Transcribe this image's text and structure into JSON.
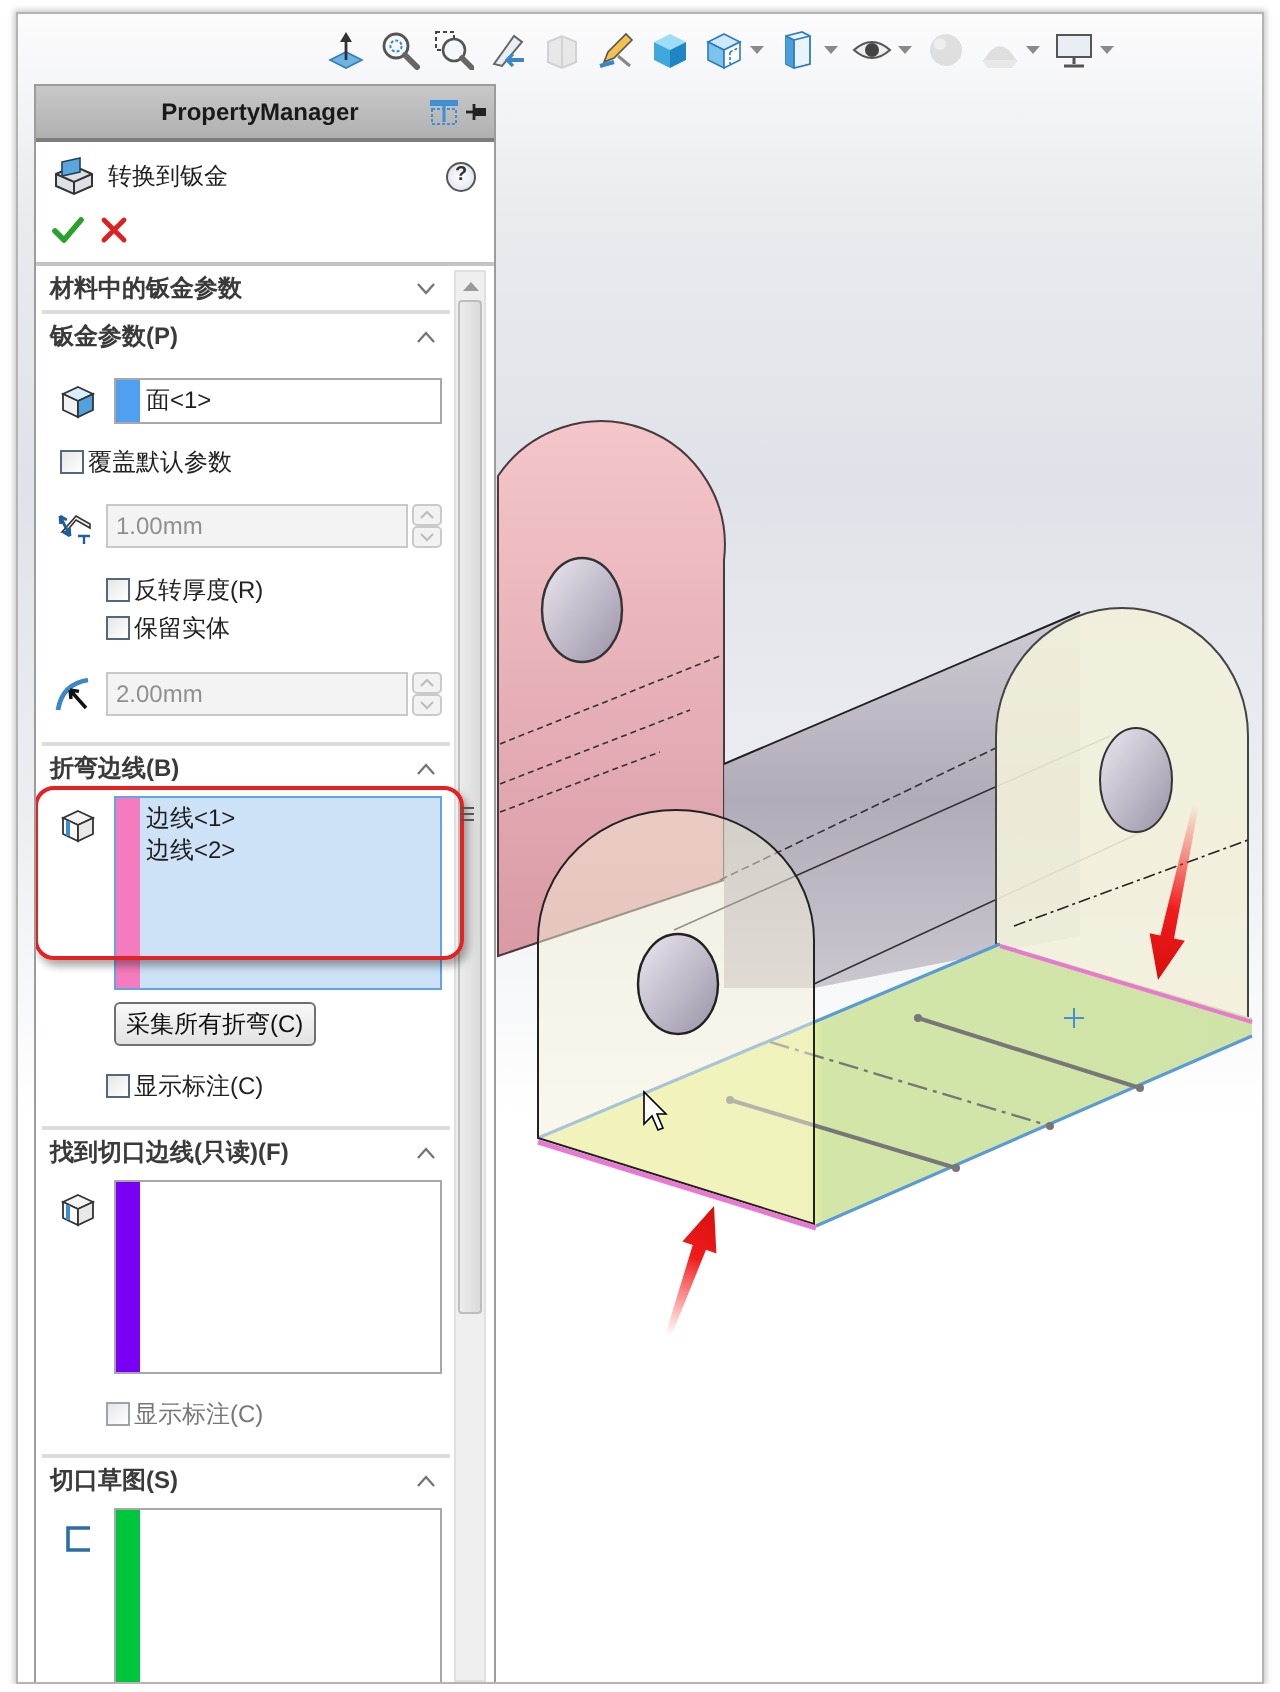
{
  "toolbar": [
    {
      "kind": "triad",
      "disabled": false,
      "menu": false
    },
    {
      "kind": "zoomfit",
      "disabled": false,
      "menu": false
    },
    {
      "kind": "zoomarea",
      "disabled": false,
      "menu": false
    },
    {
      "kind": "previous",
      "disabled": false,
      "menu": false
    },
    {
      "kind": "section",
      "disabled": true,
      "menu": false
    },
    {
      "kind": "annotation",
      "disabled": false,
      "menu": false
    },
    {
      "kind": "shaded",
      "disabled": false,
      "menu": false
    },
    {
      "kind": "hidden",
      "disabled": false,
      "menu": true
    },
    {
      "kind": "display",
      "disabled": false,
      "menu": true
    },
    {
      "kind": "eye",
      "disabled": false,
      "menu": true
    },
    {
      "kind": "appearance",
      "disabled": true,
      "menu": false
    },
    {
      "kind": "scene",
      "disabled": true,
      "menu": true
    },
    {
      "kind": "monitor",
      "disabled": false,
      "menu": true
    }
  ],
  "property_manager": {
    "header": "PropertyManager",
    "title": "转换到钣金",
    "help": "?",
    "sections": [
      {
        "title": "材料中的钣金参数",
        "expanded": false
      },
      {
        "title": "钣金参数(P)",
        "expanded": true,
        "rows": [
          {
            "kind": "face",
            "value": "面<1>",
            "color": "#4fa0f0"
          },
          {
            "kind": "checkbox",
            "label": "覆盖默认参数",
            "checked": false,
            "disabled": false
          },
          {
            "kind": "thickness",
            "value": "1.00mm",
            "disabled": true,
            "options": [
              {
                "label": "反转厚度(R)",
                "checked": false,
                "disabled": false
              },
              {
                "label": "保留实体",
                "checked": false,
                "disabled": false
              }
            ]
          },
          {
            "kind": "radius",
            "value": "2.00mm",
            "disabled": true
          }
        ]
      },
      {
        "title": "折弯边线(B)",
        "expanded": true,
        "rows": [
          {
            "kind": "edges",
            "color": "#f47bbd",
            "items": [
              "边线<1>",
              "边线<2>"
            ],
            "active": true,
            "callout": true,
            "button": "采集所有折弯(C)",
            "options": [
              {
                "label": "显示标注(C)",
                "checked": false,
                "disabled": false
              }
            ]
          }
        ]
      },
      {
        "title": "找到切口边线(只读)(F)",
        "expanded": true,
        "rows": [
          {
            "kind": "edges",
            "color": "#7a00f4",
            "active": false,
            "callout": false,
            "options": [
              {
                "label": "显示标注(C)",
                "checked": false,
                "disabled": true
              }
            ]
          }
        ]
      },
      {
        "title": "切口草图(S)",
        "expanded": true,
        "rows": [
          {
            "kind": "sketch",
            "color": "#00c63e",
            "active": false,
            "callout": false
          }
        ]
      }
    ]
  }
}
